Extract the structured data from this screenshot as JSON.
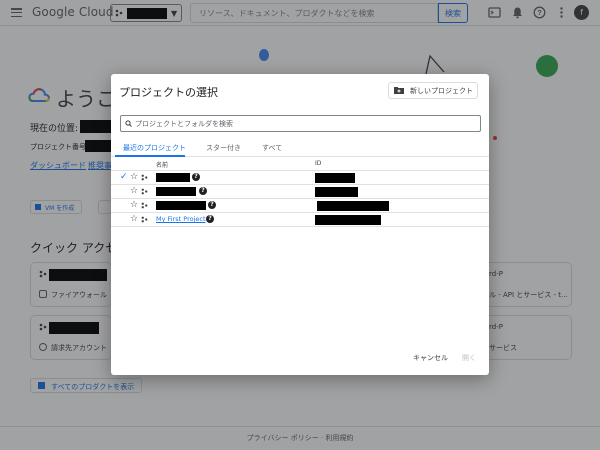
{
  "topbar": {
    "logo_text": "Google Cloud",
    "search_placeholder": "リソース、ドキュメント、プロダクトなどを検索",
    "search_button": "検索",
    "avatar_initial": "f"
  },
  "background": {
    "welcome": "ようこ",
    "location_label": "現在の位置:",
    "project_number_label": "プロジェクト番号:",
    "links": [
      "ダッシュボード",
      "推奨事"
    ],
    "vm_button": "VM を作成",
    "quick_access_title": "クイック アクセス",
    "cards": [
      "ファイアウォール",
      "請求先アカウント"
    ],
    "right_cards": [
      {
        "line1": "rd-P",
        "line2": "ル - API とサービス - t..."
      },
      {
        "line1": "rd-P",
        "line2": "サービス"
      }
    ],
    "all_products_button": "すべてのプロダクトを表示",
    "footer": "プライバシー ポリシー · 利用規約"
  },
  "dialog": {
    "title": "プロジェクトの選択",
    "new_project_button": "新しいプロジェクト",
    "search_placeholder": "プロジェクトとフォルダを検索",
    "tabs": [
      "最近のプロジェクト",
      "スター付き",
      "すべて"
    ],
    "active_tab": 0,
    "columns": {
      "name": "名前",
      "id": "ID"
    },
    "rows": [
      {
        "name": "",
        "selected": true,
        "has_help": true,
        "redacted": true
      },
      {
        "name": "",
        "selected": false,
        "has_help": true,
        "redacted": true
      },
      {
        "name": "",
        "selected": false,
        "has_help": true,
        "redacted": true
      },
      {
        "name": "My First Project",
        "selected": false,
        "has_help": true,
        "redacted": false
      }
    ],
    "cancel_button": "キャンセル",
    "open_button": "開く"
  },
  "colors": {
    "accent": "#1a73e8",
    "overlay": "rgba(32,33,36,0.42)"
  }
}
